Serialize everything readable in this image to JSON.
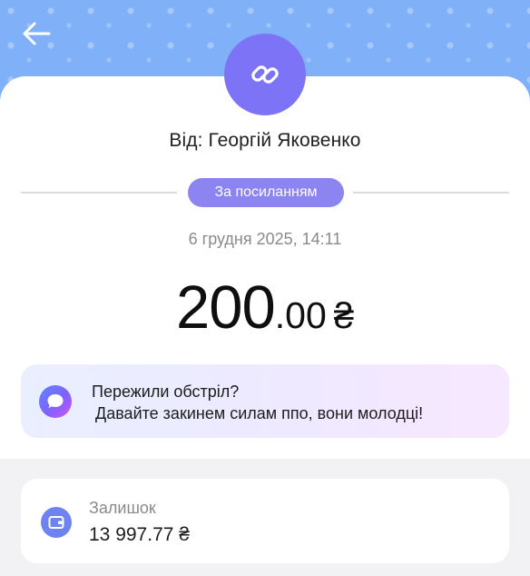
{
  "header": {
    "back_icon": "arrow-left-icon",
    "accent_color": "#80b0f8"
  },
  "transaction": {
    "icon": "link-icon",
    "from": "Від: Георгій Яковенко",
    "type_badge": "За посиланням",
    "date": "6 грудня 2025, 14:11",
    "amount_int": "200",
    "amount_dec": ".00",
    "currency": "₴"
  },
  "comment": {
    "icon": "message-icon",
    "title": "Пережили обстріл?",
    "text": "Давайте закинем силам ппо,  вони молодці!"
  },
  "balance": {
    "icon": "wallet-icon",
    "label": "Залишок",
    "value": "13 997.77 ₴"
  }
}
